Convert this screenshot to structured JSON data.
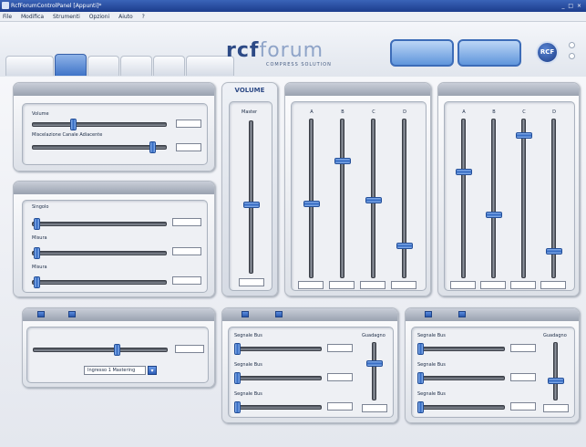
{
  "window": {
    "title": "RcfForumControlPanel [Appunti]*",
    "controls": "_ □ ×"
  },
  "menu": [
    "File",
    "Modifica",
    "Strumenti",
    "Opzioni",
    "Aiuto",
    "?"
  ],
  "tabs": [
    "",
    "",
    "",
    "",
    "",
    ""
  ],
  "logo": {
    "main_a": "rcf",
    "main_b": "forum",
    "sub": "COMPRESS SOLUTION"
  },
  "header_buttons": [
    "",
    ""
  ],
  "brand_badge": "RCF",
  "panels": {
    "general": {
      "title": "",
      "sliders": [
        {
          "label": "Volume",
          "value": "",
          "level": 0.3
        },
        {
          "label": "Miscelazione Canale Adiacente",
          "value": "",
          "level": 0.9
        }
      ]
    },
    "channels": {
      "title": "",
      "sliders": [
        {
          "label": "Singolo",
          "value": "",
          "level": 0.03
        },
        {
          "label": "Misura",
          "value": "",
          "level": 0.03
        },
        {
          "label": "Misura",
          "value": "",
          "level": 0.03
        }
      ]
    },
    "crossfade": {
      "title": "",
      "squares": [
        "",
        ""
      ],
      "left": "",
      "mid": "",
      "right": "",
      "level": 0.62,
      "value": "",
      "dropdown": "Ingresso 1 Mastering"
    },
    "volume": {
      "title": "VOLUME",
      "master_label": "Master",
      "value": "",
      "level": 0.55
    },
    "mix_a": {
      "title": "",
      "channels": [
        {
          "label": "A",
          "level": 0.53,
          "value": ""
        },
        {
          "label": "B",
          "level": 0.26,
          "value": ""
        },
        {
          "label": "C",
          "level": 0.51,
          "value": ""
        },
        {
          "label": "D",
          "level": 0.8,
          "value": ""
        }
      ]
    },
    "mix_b": {
      "title": "",
      "channels": [
        {
          "label": "A",
          "level": 0.33,
          "value": ""
        },
        {
          "label": "B",
          "level": 0.6,
          "value": ""
        },
        {
          "label": "C",
          "level": 0.1,
          "value": ""
        },
        {
          "label": "D",
          "level": 0.83,
          "value": ""
        }
      ]
    },
    "zone_a": {
      "title": "",
      "squares": [
        "",
        ""
      ],
      "gain_label": "Guadagno",
      "gain_level": 0.35,
      "gain_value": "",
      "sliders": [
        {
          "label": "Segnale Bus",
          "value": "",
          "level": 0.02
        },
        {
          "label": "Segnale Bus",
          "value": "",
          "level": 0.02
        },
        {
          "label": "Segnale Bus",
          "value": "",
          "level": 0.02
        }
      ]
    },
    "zone_b": {
      "title": "",
      "squares": [
        "",
        ""
      ],
      "gain_label": "Guadagno",
      "gain_level": 0.66,
      "gain_value": "",
      "sliders": [
        {
          "label": "Segnale Bus",
          "value": "",
          "level": 0.02
        },
        {
          "label": "Segnale Bus",
          "value": "",
          "level": 0.02
        },
        {
          "label": "Segnale Bus",
          "value": "",
          "level": 0.02
        }
      ]
    }
  }
}
